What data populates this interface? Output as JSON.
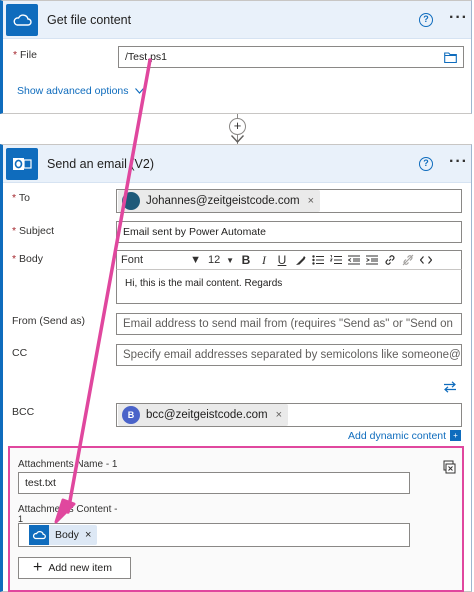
{
  "get_file": {
    "title": "Get file content",
    "file_label": "File",
    "required_mark": "*",
    "file_value": "/Test.ps1",
    "advanced_link": "Show advanced options"
  },
  "send_email": {
    "title": "Send an email (V2)",
    "to_label": "To",
    "to_token": "Johannes@zeitgeistcode.com",
    "subject_label": "Subject",
    "subject_value": "Email sent by Power Automate",
    "body_label": "Body",
    "font_name": "Font",
    "font_size": "12",
    "body_text": "Hi, this is the mail content. Regards",
    "from_label": "From (Send as)",
    "from_placeholder": "Email address to send mail from (requires \"Send as\" or \"Send on",
    "cc_label": "CC",
    "cc_placeholder": "Specify email addresses separated by semicolons like someone@",
    "bcc_label": "BCC",
    "bcc_avatar": "B",
    "bcc_token": "bcc@zeitgeistcode.com",
    "add_dynamic": "Add dynamic content",
    "attach_name_label": "Attachments Name - 1",
    "attach_name_value": "test.txt",
    "attach_content_label": "Attachments Content -",
    "attach_content_label_2": "1",
    "body_chip": "Body",
    "add_new_item": "Add new item"
  },
  "icons": {
    "help": "?",
    "more": "···",
    "close": "×",
    "plus": "+"
  },
  "colors": {
    "accent": "#0f6cbd",
    "arrow": "#e0479e",
    "header_bg": "#e9f1fa",
    "to_avatar": "#1e5a7a",
    "bcc_avatar": "#4a63c9"
  }
}
